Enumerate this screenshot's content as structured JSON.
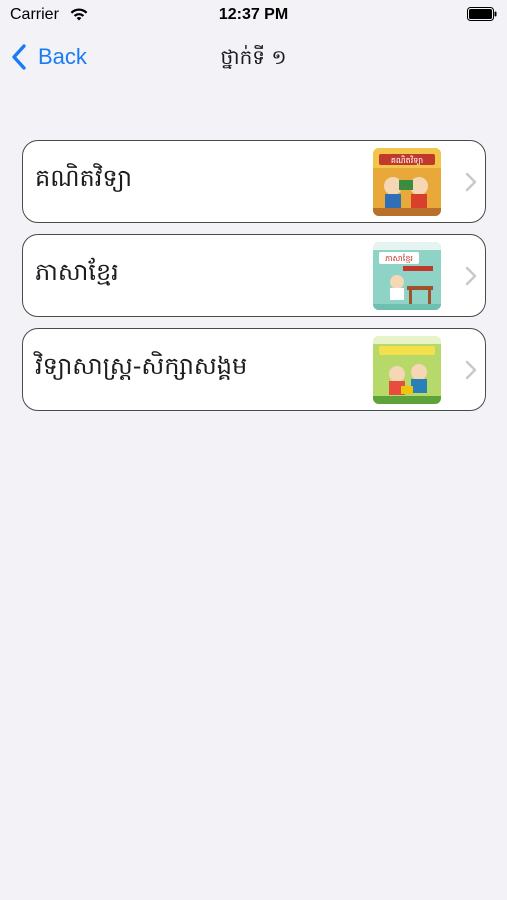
{
  "status_bar": {
    "carrier": "Carrier",
    "time": "12:37 PM",
    "icons": [
      "wifi-icon",
      "battery-icon"
    ]
  },
  "nav": {
    "back_label": "Back",
    "title": "ថ្នាក់ទី ១"
  },
  "subjects": [
    {
      "label": "គណិតវិទ្យា",
      "thumbnail_title": "គណិតវិទ្យា",
      "thumb_icon": "math-book-cover"
    },
    {
      "label": "ភាសាខ្មែរ",
      "thumbnail_title": "ភាសាខ្មែរ",
      "thumb_icon": "khmer-book-cover"
    },
    {
      "label": "វិទ្យាសាស្ត្រ-សិក្សាសង្គម",
      "thumbnail_title": "",
      "thumb_icon": "science-book-cover"
    }
  ],
  "colors": {
    "accent": "#1a7cf5",
    "background": "#f2f2f7",
    "row_border": "#4a4a4a",
    "chevron": "#c7c7cc"
  }
}
